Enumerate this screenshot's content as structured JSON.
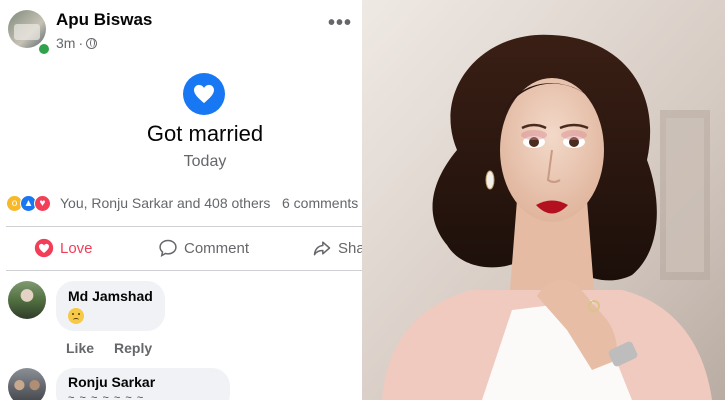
{
  "post": {
    "author": "Apu Biswas",
    "time": "3m",
    "separator": "·",
    "more": "•••",
    "life_event": {
      "title": "Got married",
      "date": "Today"
    },
    "reactions": {
      "summary": "You, Ronju Sarkar and 408 others",
      "comments": "6 comments"
    },
    "actions": {
      "love": "Love",
      "comment": "Comment",
      "share": "Share"
    }
  },
  "comments": [
    {
      "name": "Md Jamshad",
      "like": "Like",
      "reply": "Reply"
    },
    {
      "name": "Ronju Sarkar",
      "text_partial": "~ ~ ~ ~  ~ ~ ~"
    }
  ],
  "colors": {
    "facebook_blue": "#1877f2",
    "love_red": "#f33e58",
    "text_grey": "#65676b"
  }
}
